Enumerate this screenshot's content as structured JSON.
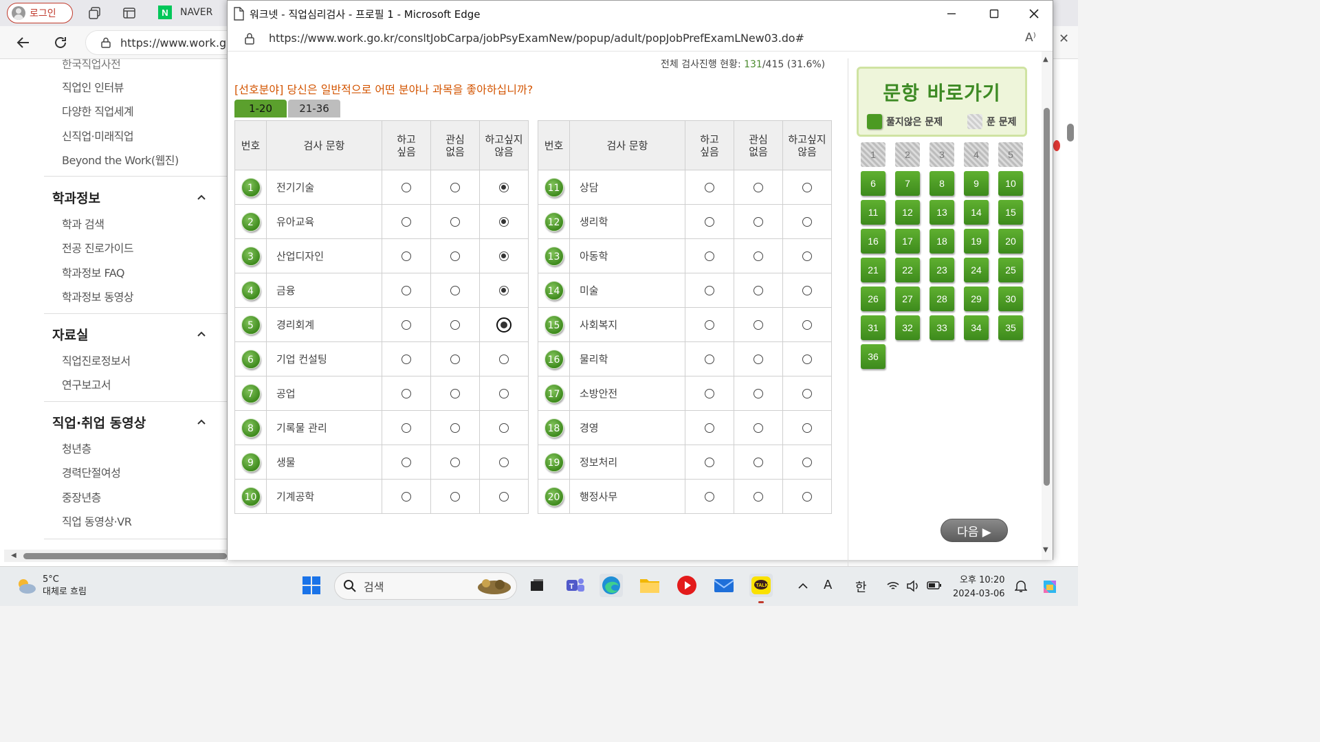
{
  "bg_browser": {
    "login_label": "로그인",
    "naver_tab": "NAVER",
    "naver_logo": "N",
    "url": "https://www.work.g",
    "sidebar": {
      "top_partial": "한국직업사전",
      "group1_items": [
        "직업인 인터뷰",
        "다양한 직업세계",
        "신직업·미래직업",
        "Beyond the Work(웹진)"
      ],
      "sections": [
        {
          "title": "학과정보",
          "items": [
            "학과 검색",
            "전공 진로가이드",
            "학과정보 FAQ",
            "학과정보 동영상"
          ]
        },
        {
          "title": "자료실",
          "items": [
            "직업진로정보서",
            "연구보고서"
          ]
        },
        {
          "title": "직업·취업 동영상",
          "items": [
            "청년층",
            "경력단절여성",
            "중장년층",
            "직업 동영상·VR"
          ]
        }
      ]
    }
  },
  "popup": {
    "window_title": "워크넷 - 직업심리검사 - 프로필 1 - Microsoft Edge",
    "url": "https://www.work.go.kr/consltJobCarpa/jobPsyExamNew/popup/adult/popJobPrefExamLNew03.do#",
    "progress": {
      "label": "전체 검사진행 현황: ",
      "done": "131",
      "rest": "/415 (31.6%)"
    },
    "question": "[선호분야] 당신은 일반적으로 어떤 분야나 과목을 좋아하십니까?",
    "tabs": [
      {
        "label": "1-20",
        "active": true
      },
      {
        "label": "21-36",
        "active": false
      }
    ],
    "headers": {
      "no": "번호",
      "item": "검사 문항",
      "like": "하고\n싶음",
      "neutral": "관심\n없음",
      "dislike": "하고싶지\n않음"
    },
    "items": [
      {
        "no": "1",
        "label": "전기기술",
        "answer": "dislike"
      },
      {
        "no": "2",
        "label": "유아교육",
        "answer": "dislike"
      },
      {
        "no": "3",
        "label": "산업디자인",
        "answer": "dislike"
      },
      {
        "no": "4",
        "label": "금융",
        "answer": "dislike"
      },
      {
        "no": "5",
        "label": "경리회계",
        "answer": "dislike",
        "focused": true
      },
      {
        "no": "6",
        "label": "기업 컨설팅",
        "answer": null
      },
      {
        "no": "7",
        "label": "공업",
        "answer": null
      },
      {
        "no": "8",
        "label": "기록물 관리",
        "answer": null
      },
      {
        "no": "9",
        "label": "생물",
        "answer": null
      },
      {
        "no": "10",
        "label": "기계공학",
        "answer": null
      },
      {
        "no": "11",
        "label": "상담",
        "answer": null
      },
      {
        "no": "12",
        "label": "생리학",
        "answer": null
      },
      {
        "no": "13",
        "label": "아동학",
        "answer": null
      },
      {
        "no": "14",
        "label": "미술",
        "answer": null
      },
      {
        "no": "15",
        "label": "사회복지",
        "answer": null
      },
      {
        "no": "16",
        "label": "물리학",
        "answer": null
      },
      {
        "no": "17",
        "label": "소방안전",
        "answer": null
      },
      {
        "no": "18",
        "label": "경영",
        "answer": null
      },
      {
        "no": "19",
        "label": "정보처리",
        "answer": null
      },
      {
        "no": "20",
        "label": "행정사무",
        "answer": null
      }
    ],
    "side": {
      "title": "문항 바로가기",
      "legend_todo": "풀지않은 문제",
      "legend_done": "푼 문제",
      "answered": [
        "1",
        "2",
        "3",
        "4",
        "5"
      ],
      "total": 36,
      "next_label": "다음 ▶"
    }
  },
  "taskbar": {
    "temp": "5°C",
    "weather": "대체로 흐림",
    "search_placeholder": "검색",
    "ime_a": "A",
    "ime_han": "한",
    "time": "오후 10:20",
    "date": "2024-03-06",
    "kakao": "TALK"
  },
  "colors": {
    "accent_green": "#4b9a22",
    "question_orange": "#d35400",
    "login_red": "#c0392b"
  }
}
